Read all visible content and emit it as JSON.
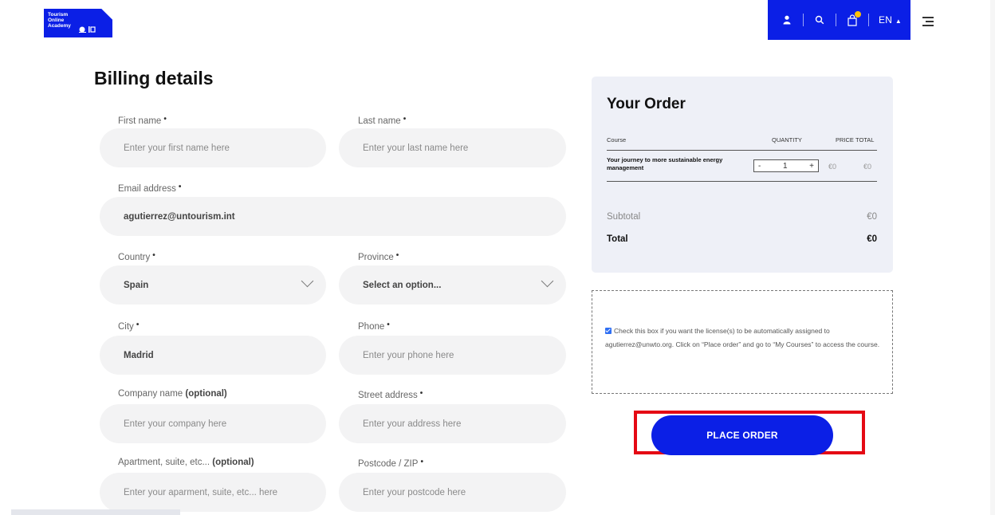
{
  "brand": {
    "logo_lines": [
      "Tourism",
      "Online",
      "Academy"
    ],
    "accent": "#0b1fe6"
  },
  "header": {
    "icons": [
      "user-icon",
      "search-icon",
      "cart-icon",
      "chevron-up-icon",
      "menu-icon"
    ],
    "language": "EN"
  },
  "billing": {
    "title": "Billing details",
    "required_mark": "•",
    "fields": {
      "first_name": {
        "label": "First name",
        "placeholder": "Enter your first name here"
      },
      "last_name": {
        "label": "Last name",
        "placeholder": "Enter your last name here"
      },
      "email": {
        "label": "Email address",
        "value": "agutierrez@untourism.int"
      },
      "country": {
        "label": "Country",
        "value": "Spain"
      },
      "province": {
        "label": "Province",
        "value": "Select an option..."
      },
      "city": {
        "label": "City",
        "value": "Madrid"
      },
      "phone": {
        "label": "Phone",
        "placeholder": "Enter your phone here"
      },
      "company": {
        "label": "Company name",
        "optional": "(optional)",
        "placeholder": "Enter your company here"
      },
      "street": {
        "label": "Street address",
        "placeholder": "Enter your address here"
      },
      "apartment": {
        "label": "Apartment, suite, etc...",
        "optional": "(optional)",
        "placeholder": "Enter your aparment, suite, etc... here"
      },
      "postcode": {
        "label": "Postcode / ZIP",
        "placeholder": "Enter your postcode here"
      }
    }
  },
  "order": {
    "title": "Your Order",
    "columns": {
      "course": "Course",
      "quantity": "QUANTITY",
      "price": "PRICE",
      "total": "TOTAL"
    },
    "item": {
      "name": "Your journey to more sustainable energy management",
      "quantity": "1",
      "minus": "-",
      "plus": "+",
      "price": "€0",
      "total": "€0"
    },
    "subtotal_label": "Subtotal",
    "subtotal_value": "€0",
    "total_label": "Total",
    "total_value": "€0"
  },
  "license": {
    "checked": true,
    "text": "Check this box if you want the license(s) to be automatically assigned to agutierrez@unwto.org. Click on “Place order” and go to “My Courses” to access the course."
  },
  "place_order_label": "PLACE ORDER",
  "highlight_color": "#e50914"
}
